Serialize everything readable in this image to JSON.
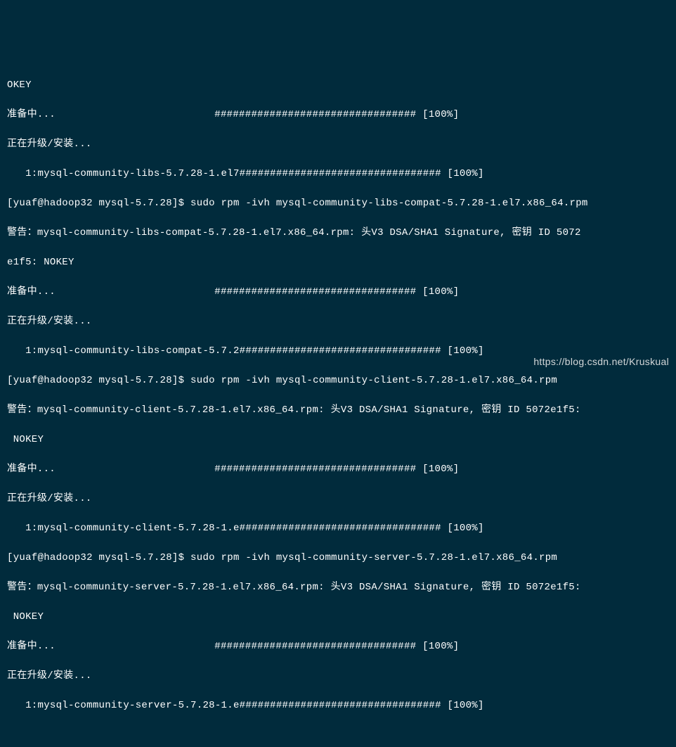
{
  "lines": [
    "OKEY",
    "准备中...                          ################################# [100%]",
    "正在升级/安装...",
    "   1:mysql-community-libs-5.7.28-1.el7################################# [100%]",
    "[yuaf@hadoop32 mysql-5.7.28]$ sudo rpm -ivh mysql-community-libs-compat-5.7.28-1.el7.x86_64.rpm",
    "警告：mysql-community-libs-compat-5.7.28-1.el7.x86_64.rpm: 头V3 DSA/SHA1 Signature, 密钥 ID 5072",
    "e1f5: NOKEY",
    "准备中...                          ################################# [100%]",
    "正在升级/安装...",
    "   1:mysql-community-libs-compat-5.7.2################################# [100%]",
    "[yuaf@hadoop32 mysql-5.7.28]$ sudo rpm -ivh mysql-community-client-5.7.28-1.el7.x86_64.rpm",
    "警告：mysql-community-client-5.7.28-1.el7.x86_64.rpm: 头V3 DSA/SHA1 Signature, 密钥 ID 5072e1f5:",
    " NOKEY",
    "准备中...                          ################################# [100%]",
    "正在升级/安装...",
    "   1:mysql-community-client-5.7.28-1.e################################# [100%]",
    "[yuaf@hadoop32 mysql-5.7.28]$ sudo rpm -ivh mysql-community-server-5.7.28-1.el7.x86_64.rpm",
    "警告：mysql-community-server-5.7.28-1.el7.x86_64.rpm: 头V3 DSA/SHA1 Signature, 密钥 ID 5072e1f5:",
    " NOKEY",
    "准备中...                          ################################# [100%]",
    "正在升级/安装...",
    "   1:mysql-community-server-5.7.28-1.e################################# [100%]"
  ],
  "watermark": "https://blog.csdn.net/Kruskual"
}
